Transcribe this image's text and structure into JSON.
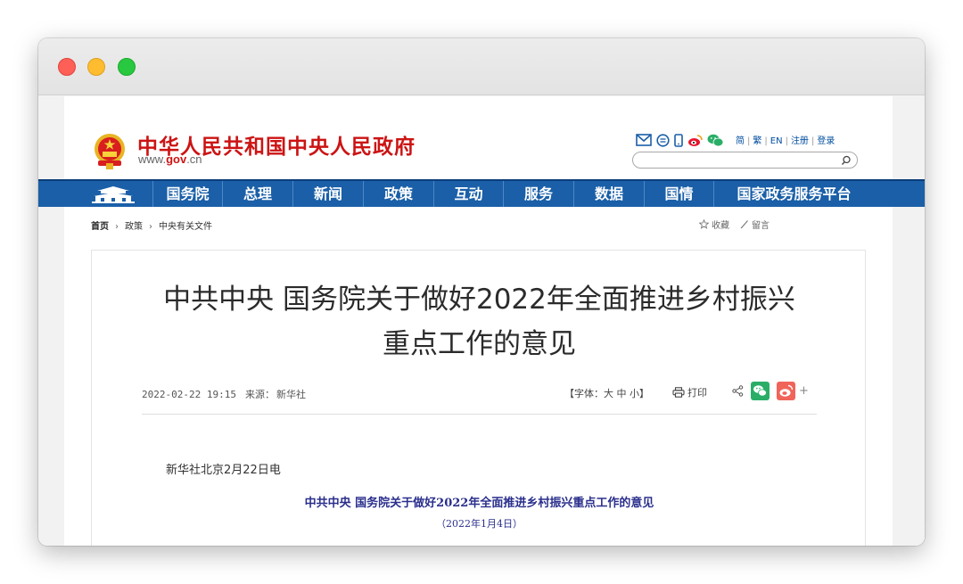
{
  "header": {
    "site_title": "中华人民共和国中央人民政府",
    "url_prefix": "www.",
    "url_domain": "gov",
    "url_suffix": ".cn",
    "icons": [
      "mail-icon",
      "message-icon",
      "mobile-icon",
      "weibo-icon",
      "wechat-icon"
    ],
    "lang_links": [
      "简",
      "繁",
      "EN"
    ],
    "account_links": [
      "注册",
      "登录"
    ],
    "search_placeholder": ""
  },
  "nav": {
    "items": [
      "国务院",
      "总理",
      "新闻",
      "政策",
      "互动",
      "服务",
      "数据",
      "国情",
      "国家政务服务平台"
    ]
  },
  "breadcrumb": {
    "home": "首页",
    "items": [
      "政策",
      "中央有关文件"
    ],
    "separator": "›"
  },
  "tools": {
    "favorite": "收藏",
    "comment": "留言"
  },
  "article": {
    "title_line1": "中共中央 国务院关于做好2022年全面推进乡村振兴",
    "title_line2": "重点工作的意见",
    "datetime": "2022-02-22 19:15",
    "source_label": "来源：",
    "source": "新华社",
    "font_size_text": "【字体：大 中 小】",
    "print_label": "打印",
    "share_plus": "+",
    "dateline": "新华社北京2月22日电",
    "doc_title": "中共中央  国务院关于做好2022年全面推进乡村振兴重点工作的意见",
    "doc_date": "（2022年1月4日）"
  },
  "colors": {
    "brand_red": "#cc1414",
    "nav_blue": "#1a5fa8",
    "doc_blue": "#2a2f8c"
  }
}
